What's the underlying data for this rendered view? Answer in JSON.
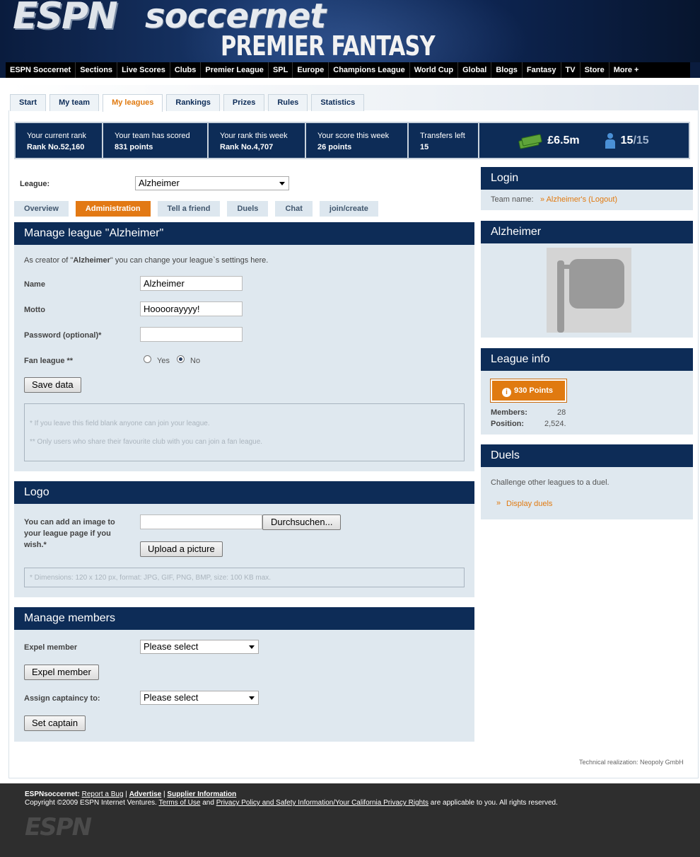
{
  "header": {
    "brand_espn": "ESPN",
    "brand_soccernet": "soccernet",
    "brand_sub": "PREMIER FANTASY"
  },
  "topnav": [
    "ESPN Soccernet",
    "Sections",
    "Live Scores",
    "Clubs",
    "Premier League",
    "SPL",
    "Europe",
    "Champions League",
    "World Cup",
    "Global",
    "Blogs",
    "Fantasy",
    "TV",
    "Store",
    "More +"
  ],
  "tabs": [
    "Start",
    "My team",
    "My leagues",
    "Rankings",
    "Prizes",
    "Rules",
    "Statistics"
  ],
  "stats": {
    "rank_label": "Your current rank",
    "rank_value": "Rank No.52,160",
    "scored_label": "Your team has scored",
    "scored_value": "831 points",
    "week_rank_label": "Your rank this week",
    "week_rank_value": "Rank No.4,707",
    "week_score_label": "Your score this week",
    "week_score_value": "26 points",
    "transfers_label": "Transfers left",
    "transfers_value": "15",
    "money": "£6.5m",
    "squad_have": "15",
    "squad_total": "/15"
  },
  "league": {
    "label": "League:",
    "selected": "Alzheimer"
  },
  "subtabs": [
    "Overview",
    "Administration",
    "Tell a friend",
    "Duels",
    "Chat",
    "join/create"
  ],
  "manage": {
    "title": "Manage league \"Alzheimer\"",
    "intro_pre": "As creator of \"",
    "intro_name": "Alzheimer",
    "intro_post": "\" you can change your league`s settings here.",
    "name_label": "Name",
    "name_value": "Alzheimer",
    "motto_label": "Motto",
    "motto_value": "Hoooorayyyy!",
    "password_label": "Password (optional)*",
    "password_value": "",
    "fan_label": "Fan league **",
    "yes": "Yes",
    "no": "No",
    "fan_selected": "No",
    "save_button": "Save data",
    "note1": "* If you leave this field blank anyone can join your league.",
    "note2": "** Only users who share their favourite club with you can join a fan league."
  },
  "logo": {
    "title": "Logo",
    "text": "You can add an image to your league page if you wish.*",
    "browse": "Durchsuchen...",
    "upload": "Upload a picture",
    "note": "* Dimensions: 120 x 120 px, format: JPG, GIF, PNG, BMP, size: 100 KB max."
  },
  "members": {
    "title": "Manage members",
    "expel_label": "Expel member",
    "expel_select": "Please select",
    "expel_button": "Expel member",
    "captain_label": "Assign captaincy to:",
    "captain_select": "Please select",
    "captain_button": "Set captain"
  },
  "login": {
    "title": "Login",
    "team_label": "Team name:",
    "team_link": "» Alzheimer's (Logout)"
  },
  "league_card": {
    "title": "Alzheimer"
  },
  "league_info": {
    "title": "League info",
    "points": "930 Points",
    "members_label": "Members:",
    "members_value": "28",
    "position_label": "Position:",
    "position_value": "2,524."
  },
  "duels": {
    "title": "Duels",
    "text": "Challenge other leagues to a duel.",
    "link": "Display duels"
  },
  "tech": "Technical realization: Neopoly GmbH",
  "footer": {
    "brand": "ESPNsoccernet:",
    "report": "Report a Bug",
    "advertise": "Advertise",
    "supplier": "Supplier Information",
    "copyright": "Copyright ©2009 ESPN Internet Ventures.",
    "terms": "Terms of Use",
    "and": "and",
    "privacy": "Privacy Policy and Safety Information/Your California Privacy Rights",
    "rest": "are applicable to you. All rights reserved.",
    "logo": "ESPN"
  }
}
